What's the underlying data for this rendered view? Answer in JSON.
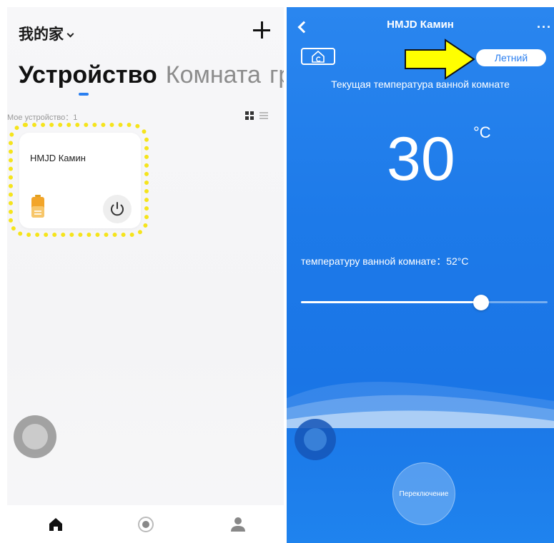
{
  "left": {
    "home_title": "我的家",
    "tabs": [
      {
        "label": "Устройство",
        "active": true
      },
      {
        "label": "Комната",
        "active": false
      },
      {
        "label": "гр",
        "active": false
      }
    ],
    "device_count": "Мое устройство：1",
    "devices": [
      {
        "name": "HMJD Камин",
        "icon": "heater-icon",
        "power_icon": "power-icon"
      }
    ],
    "highlight_color": "#f5e41c",
    "accent_color": "#2a7ff0",
    "bottom_nav": [
      {
        "icon": "home-icon",
        "active": true
      },
      {
        "icon": "smart-icon",
        "active": false
      },
      {
        "icon": "profile-icon",
        "active": false
      }
    ]
  },
  "right": {
    "title": "HMJD Камин",
    "mode_label": "Летний",
    "current_label": "Текущая температура ванной комнате",
    "current_temp": "30",
    "unit": "°C",
    "set_label": "температуру ванной комнате：52°C",
    "slider_level": 0.73,
    "switch_label": "Переключение",
    "background_color": "#1d7ae9",
    "arrow_color": "#ffff00"
  }
}
